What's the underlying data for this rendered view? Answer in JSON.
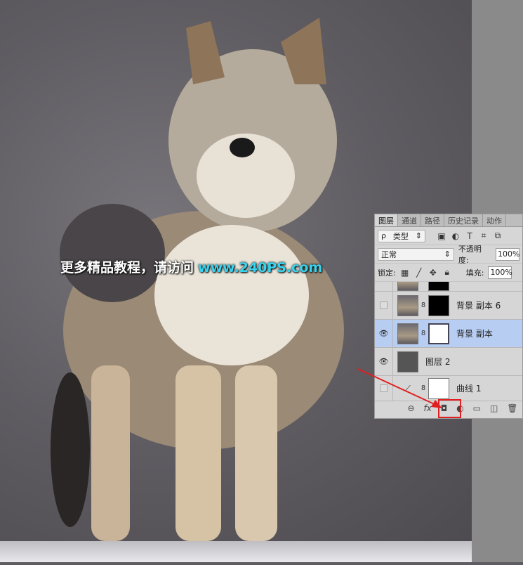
{
  "watermark": {
    "text": "更多精品教程，请访问",
    "url": "www.240PS.com"
  },
  "panel": {
    "tabs": [
      "图层",
      "通道",
      "路径",
      "历史记录",
      "动作"
    ],
    "filter": {
      "label": "类型",
      "search_icon": "ρ"
    },
    "blend_mode": "正常",
    "opacity_label": "不透明度:",
    "opacity": "100%",
    "lock_label": "锁定:",
    "fill_label": "填充:",
    "fill": "100%",
    "layers": [
      {
        "name": "背景 副本 6",
        "visible": false
      },
      {
        "name": "背景 副本",
        "visible": true,
        "selected": true
      },
      {
        "name": "图层 2",
        "visible": true
      },
      {
        "name": "曲线 1",
        "visible": false
      }
    ],
    "colors": {
      "selected": "#b7cdf2",
      "highlight": "#e02020"
    }
  }
}
